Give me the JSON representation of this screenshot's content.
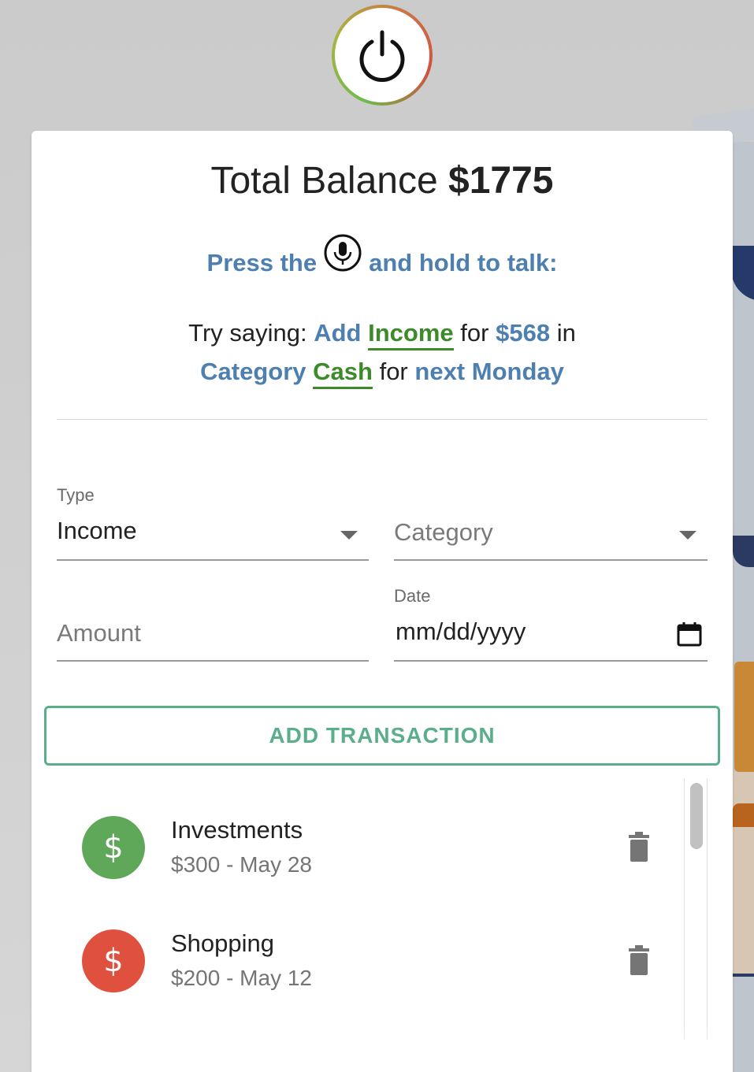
{
  "header": {
    "power_icon": "power-icon"
  },
  "balance": {
    "label": "Total Balance",
    "amount": "$1775"
  },
  "instructions": {
    "prefix": "Press the",
    "mic_icon": "microphone-icon",
    "suffix": "and hold to talk:"
  },
  "example": {
    "try": "Try saying:",
    "add": "Add",
    "income": "Income",
    "for1": "for",
    "amount": "$568",
    "in": "in",
    "category": "Category",
    "cash": "Cash",
    "for2": "for",
    "when": "next Monday"
  },
  "form": {
    "type_label": "Type",
    "type_value": "Income",
    "category_placeholder": "Category",
    "amount_placeholder": "Amount",
    "date_label": "Date",
    "date_value": "mm/dd/yyyy",
    "submit_label": "ADD TRANSACTION"
  },
  "transactions": [
    {
      "title": "Investments",
      "subtitle": "$300 - May 28",
      "symbol": "$",
      "color": "#5fa85a",
      "type": "income"
    },
    {
      "title": "Shopping",
      "subtitle": "$200 - May 12",
      "symbol": "$",
      "color": "#e0503f",
      "type": "expense"
    }
  ],
  "colors": {
    "accent_blue": "#4d7fb0",
    "accent_green": "#3d8a29",
    "button_green": "#5aae8a"
  }
}
